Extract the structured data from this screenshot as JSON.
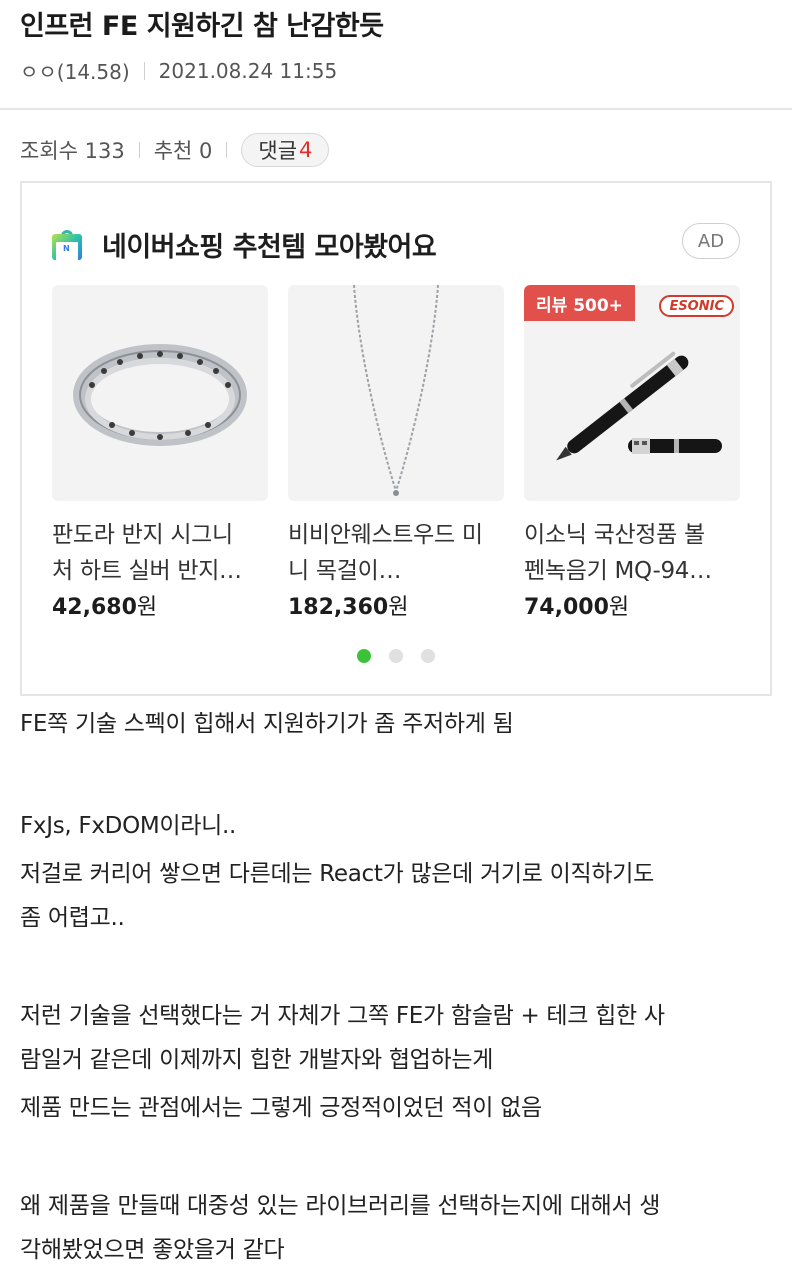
{
  "post": {
    "title": "인프런 FE 지원하긴 참 난감한듯",
    "author": "ㅇㅇ(14.58)",
    "date": "2021.08.24 11:55"
  },
  "stats": {
    "views_label": "조회수 133",
    "recommend_label": "추천 0",
    "comment_label": "댓글",
    "comment_count": "4"
  },
  "ad": {
    "title": "네이버쇼핑 추천템 모아봤어요",
    "badge": "AD",
    "products": [
      {
        "name_line1": "판도라 반지 시그니",
        "name_line2": "처 하트 실버 반지…",
        "price": "42,680",
        "unit": "원"
      },
      {
        "name_line1": "비비안웨스트우드 미",
        "name_line2": "니 목걸이…",
        "price": "182,360",
        "unit": "원"
      },
      {
        "name_line1": "이소닉 국산정품 볼",
        "name_line2": "펜녹음기 MQ-94…",
        "price": "74,000",
        "unit": "원",
        "review_badge": "리뷰 500+",
        "brand": "ESONIC"
      }
    ],
    "page_count": 3,
    "active_page": 1
  },
  "body": {
    "lines": [
      "FE쪽 기술 스펙이 힙해서 지원하기가 좀 주저하게 됨",
      "FxJs, FxDOM이라니..",
      "저걸로 커리어 쌓으면 다른데는 React가 많은데 거기로 이직하기도",
      "좀 어렵고..",
      "저런 기술을 선택했다는 거 자체가 그쪽 FE가 함슬람 + 테크 힙한 사",
      "람일거 같은데 이제까지 힙한 개발자와 협업하는게",
      "제품 만드는 관점에서는 그렇게 긍정적이었던 적이 없음",
      "왜 제품을 만들때 대중성 있는 라이브러리를 선택하는지에 대해서 생",
      "각해봤었으면 좋았을거 같다"
    ]
  },
  "colors": {
    "accent_green": "#3cc23a",
    "review_red": "#e2504c",
    "comment_red": "#e0302a"
  }
}
